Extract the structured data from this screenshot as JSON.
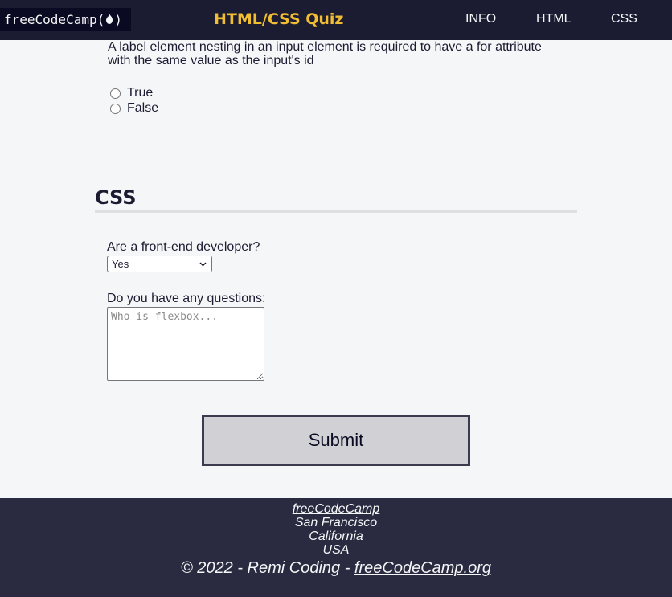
{
  "header": {
    "logo_text": "freeCodeCamp(",
    "logo_close": ")",
    "flame_icon": "flame-icon",
    "title": "HTML/CSS Quiz",
    "nav": [
      "INFO",
      "HTML",
      "CSS"
    ]
  },
  "html_question": {
    "text": "A label element nesting in an input element is required to have a for attribute with the same value as the input's id",
    "options": [
      "True",
      "False"
    ]
  },
  "css_section": {
    "title": "CSS",
    "frontend_label": "Are a front-end developer?",
    "frontend_selected": "Yes",
    "questions_label": "Do you have any questions:",
    "questions_placeholder": "Who is flexbox..."
  },
  "submit_label": "Submit",
  "footer": {
    "link_text": "freeCodeCamp",
    "address": [
      "San Francisco",
      "California",
      "USA"
    ],
    "copyright_prefix": "© 2022 - Remi Coding - ",
    "copyright_link": "freeCodeCamp.org"
  },
  "colors": {
    "header_bg": "#1b1b32",
    "title_accent": "#f1be32",
    "page_bg": "#f5f6f7",
    "footer_bg": "#2a2a40"
  }
}
